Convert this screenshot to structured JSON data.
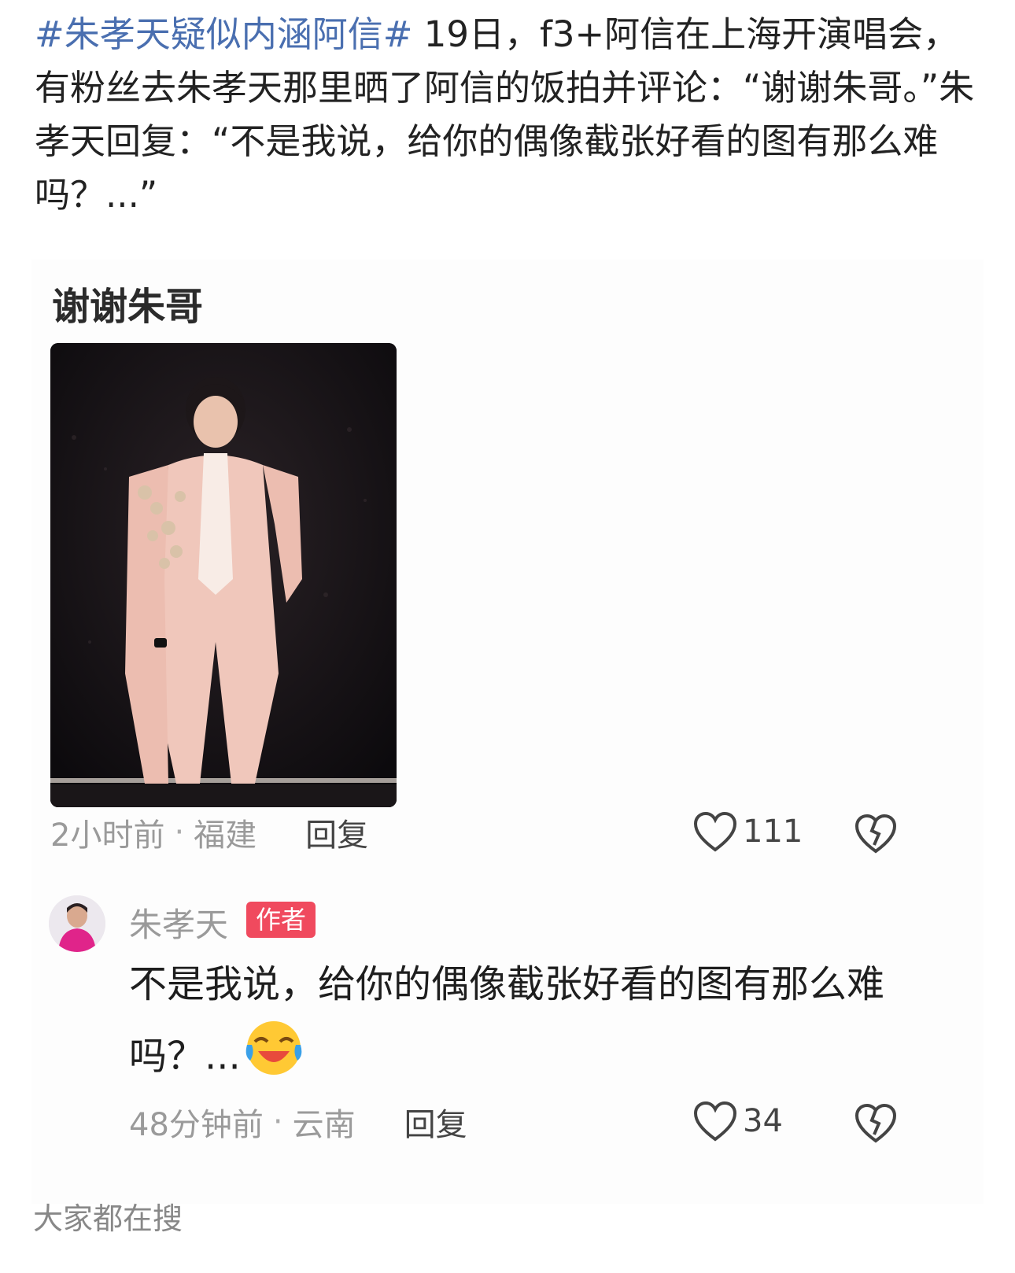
{
  "post": {
    "hashtag": "#朱孝天疑似内涵阿信#",
    "body": " 19日，f3+阿信在上海开演唱会，有粉丝去朱孝天那里晒了阿信的饭拍并评论：“谢谢朱哥。”朱孝天回复：“不是我说，给你的偶像截张好看的图有那么难吗？...”"
  },
  "comment": {
    "text": "谢谢朱哥",
    "photo_icon": "concert-photo",
    "time": "2小时前",
    "location": "福建",
    "reply_label": "回复",
    "likes": "111",
    "like_icon": "heart-outline-icon",
    "dislike_icon": "broken-heart-icon"
  },
  "reply": {
    "author": "朱孝天",
    "badge": "作者",
    "text": "不是我说，给你的偶像截张好看的图有那么难吗？...",
    "emoji_icon": "laughing-crying-emoji-icon",
    "time": "48分钟前",
    "location": "云南",
    "reply_label": "回复",
    "likes": "34"
  },
  "footer": {
    "label": "大家都在搜"
  },
  "colors": {
    "hashtag": "#4a6fb0",
    "badge": "#f04a5e",
    "muted": "#9a9a9a"
  }
}
